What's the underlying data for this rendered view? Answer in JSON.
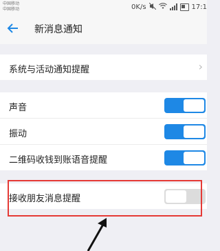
{
  "statusbar": {
    "carrier1": "中国移动",
    "carrier2": "中国移动",
    "speed": "0K/s",
    "time": "17:1"
  },
  "header": {
    "title": "新消息通知",
    "back_icon": "arrow-left-icon"
  },
  "colors": {
    "accent": "#1e88e5",
    "highlight": "#e53935",
    "toggle_off": "#dcdcdc",
    "background": "#efeff4"
  },
  "groups": [
    {
      "items": [
        {
          "label": "系统与活动通知提醒",
          "type": "chevron"
        }
      ]
    },
    {
      "items": [
        {
          "label": "声音",
          "type": "toggle",
          "on": true
        },
        {
          "label": "振动",
          "type": "toggle",
          "on": true
        },
        {
          "label": "二维码收钱到账语音提醒",
          "type": "toggle",
          "on": true
        }
      ]
    },
    {
      "items": [
        {
          "label": "接收朋友消息提醒",
          "type": "toggle",
          "on": false
        }
      ]
    }
  ]
}
